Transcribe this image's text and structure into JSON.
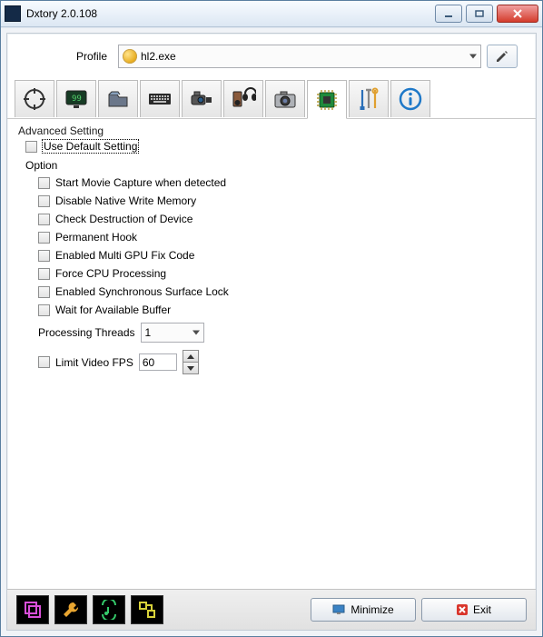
{
  "window": {
    "title": "Dxtory 2.0.108"
  },
  "profile": {
    "label": "Profile",
    "value": "hl2.exe"
  },
  "tabs": [
    {
      "name": "target"
    },
    {
      "name": "overlay"
    },
    {
      "name": "folder"
    },
    {
      "name": "hotkey"
    },
    {
      "name": "video"
    },
    {
      "name": "audio"
    },
    {
      "name": "screenshot"
    },
    {
      "name": "advanced"
    },
    {
      "name": "third-party"
    },
    {
      "name": "info"
    }
  ],
  "advanced": {
    "group_title": "Advanced Setting",
    "use_default": {
      "label": "Use Default Setting",
      "checked": false
    },
    "option_label": "Option",
    "options": [
      {
        "label": "Start Movie Capture when detected",
        "checked": false
      },
      {
        "label": "Disable Native Write Memory",
        "checked": false
      },
      {
        "label": "Check Destruction of Device",
        "checked": false
      },
      {
        "label": "Permanent Hook",
        "checked": false
      },
      {
        "label": "Enabled Multi GPU Fix Code",
        "checked": false
      },
      {
        "label": "Force CPU Processing",
        "checked": false
      },
      {
        "label": "Enabled Synchronous Surface Lock",
        "checked": false
      },
      {
        "label": "Wait for Available Buffer",
        "checked": false
      }
    ],
    "threads": {
      "label": "Processing Threads",
      "value": "1"
    },
    "limit_fps": {
      "label": "Limit Video FPS",
      "value": "60",
      "checked": false
    }
  },
  "bottom": {
    "minimize": "Minimize",
    "exit": "Exit"
  }
}
